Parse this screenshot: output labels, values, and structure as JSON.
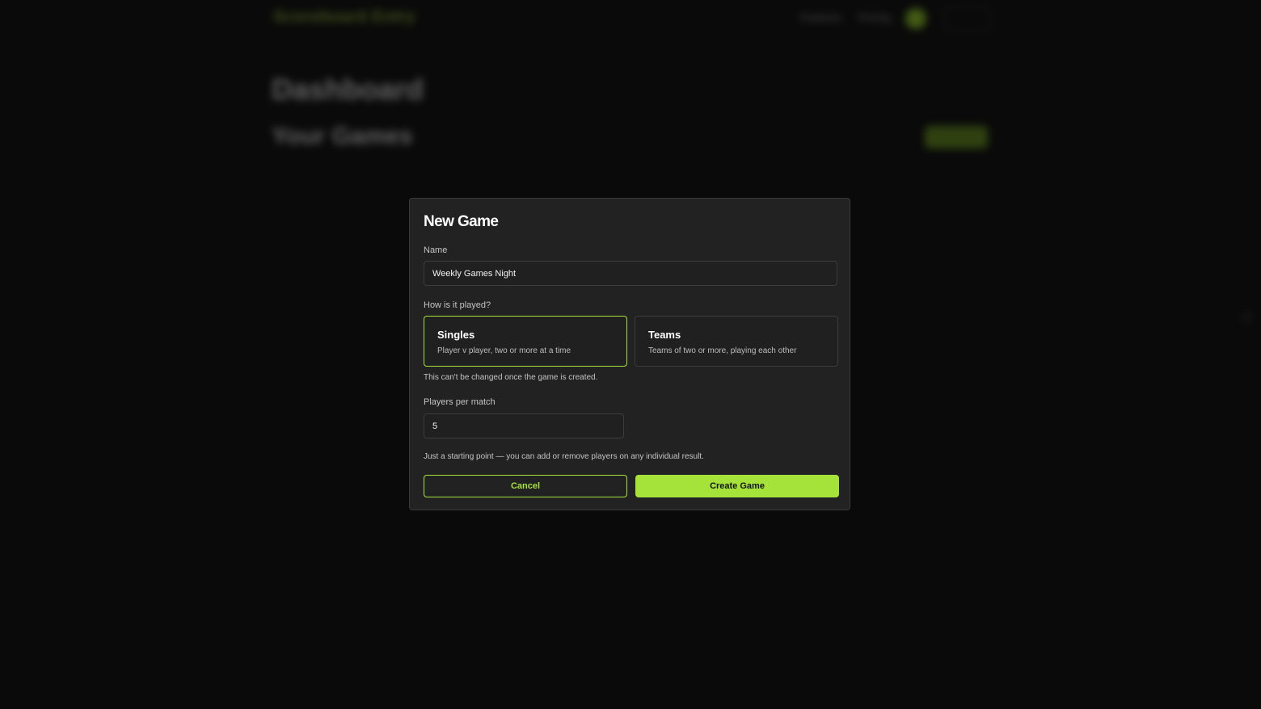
{
  "background": {
    "logo": "Scoreboard Entry",
    "nav_items": [
      "Features",
      "Pricing"
    ],
    "page_title": "Dashboard",
    "section_title": "Your Games"
  },
  "modal": {
    "title": "New Game",
    "name_label": "Name",
    "name_value": "Weekly Games Night",
    "play_label": "How is it played?",
    "options": [
      {
        "title": "Singles",
        "description": "Player v player, two or more at a time",
        "selected": true
      },
      {
        "title": "Teams",
        "description": "Teams of two or more, playing each other",
        "selected": false
      }
    ],
    "play_hint": "This can't be changed once the game is created.",
    "players_label": "Players per match",
    "players_value": "5",
    "players_hint": "Just a starting point — you can add or remove players on any individual result.",
    "cancel_label": "Cancel",
    "create_label": "Create Game"
  },
  "colors": {
    "accent": "#a6e33a",
    "modal_bg": "#222222",
    "page_bg": "#0a0a0a"
  }
}
